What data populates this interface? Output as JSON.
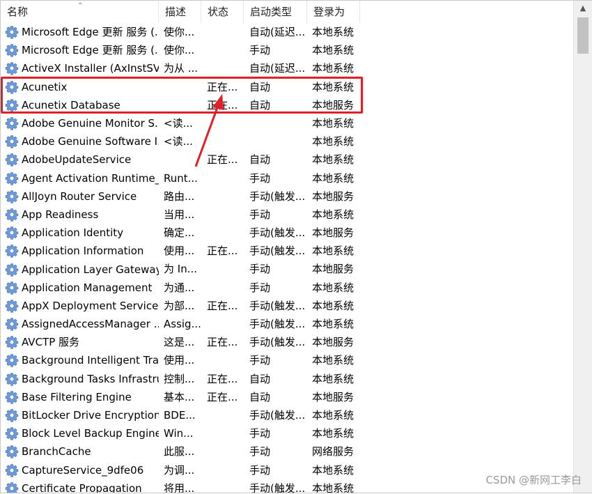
{
  "columns": {
    "name": "名称",
    "description": "描述",
    "status": "状态",
    "startup_type": "启动类型",
    "logon_as": "登录为"
  },
  "services": [
    {
      "name": "Microsoft Edge 更新 服务 (...",
      "description": "使你...",
      "status": "",
      "startup_type": "自动(延迟...",
      "logon_as": "本地系统"
    },
    {
      "name": "Microsoft Edge 更新 服务 (...",
      "description": "使你...",
      "status": "",
      "startup_type": "手动",
      "logon_as": "本地系统"
    },
    {
      "name": "ActiveX Installer (AxInstSV)",
      "description": "为从 ...",
      "status": "",
      "startup_type": "自动(延迟...",
      "logon_as": "本地系统"
    },
    {
      "name": "Acunetix",
      "description": "",
      "status": "正在...",
      "startup_type": "自动",
      "logon_as": "本地系统"
    },
    {
      "name": "Acunetix Database",
      "description": "",
      "status": "正在...",
      "startup_type": "自动",
      "logon_as": "本地服务"
    },
    {
      "name": "Adobe Genuine Monitor S...",
      "description": "<读...",
      "status": "",
      "startup_type": "",
      "logon_as": "本地系统"
    },
    {
      "name": "Adobe Genuine Software I...",
      "description": "<读...",
      "status": "",
      "startup_type": "",
      "logon_as": "本地系统"
    },
    {
      "name": "AdobeUpdateService",
      "description": "",
      "status": "正在...",
      "startup_type": "自动",
      "logon_as": "本地系统"
    },
    {
      "name": "Agent Activation Runtime_...",
      "description": "Runt...",
      "status": "",
      "startup_type": "手动",
      "logon_as": "本地系统"
    },
    {
      "name": "AllJoyn Router Service",
      "description": "路由...",
      "status": "",
      "startup_type": "手动(触发...",
      "logon_as": "本地服务"
    },
    {
      "name": "App Readiness",
      "description": "当用...",
      "status": "",
      "startup_type": "手动",
      "logon_as": "本地系统"
    },
    {
      "name": "Application Identity",
      "description": "确定...",
      "status": "",
      "startup_type": "手动(触发...",
      "logon_as": "本地服务"
    },
    {
      "name": "Application Information",
      "description": "使用...",
      "status": "正在...",
      "startup_type": "手动(触发...",
      "logon_as": "本地系统"
    },
    {
      "name": "Application Layer Gateway ...",
      "description": "为 In...",
      "status": "",
      "startup_type": "手动",
      "logon_as": "本地服务"
    },
    {
      "name": "Application Management",
      "description": "为通...",
      "status": "",
      "startup_type": "手动",
      "logon_as": "本地系统"
    },
    {
      "name": "AppX Deployment Service ...",
      "description": "为部...",
      "status": "正在...",
      "startup_type": "手动(触发...",
      "logon_as": "本地系统"
    },
    {
      "name": "AssignedAccessManager ...",
      "description": "Assig...",
      "status": "",
      "startup_type": "手动(触发...",
      "logon_as": "本地系统"
    },
    {
      "name": "AVCTP 服务",
      "description": "这是...",
      "status": "正在...",
      "startup_type": "手动(触发...",
      "logon_as": "本地服务"
    },
    {
      "name": "Background Intelligent Tra...",
      "description": "使用...",
      "status": "",
      "startup_type": "手动",
      "logon_as": "本地系统"
    },
    {
      "name": "Background Tasks Infrastru...",
      "description": "控制...",
      "status": "正在...",
      "startup_type": "自动",
      "logon_as": "本地系统"
    },
    {
      "name": "Base Filtering Engine",
      "description": "基本...",
      "status": "正在...",
      "startup_type": "自动",
      "logon_as": "本地服务"
    },
    {
      "name": "BitLocker Drive Encryption ...",
      "description": "BDE...",
      "status": "",
      "startup_type": "手动(触发...",
      "logon_as": "本地系统"
    },
    {
      "name": "Block Level Backup Engine ...",
      "description": "Win...",
      "status": "",
      "startup_type": "手动",
      "logon_as": "本地系统"
    },
    {
      "name": "BranchCache",
      "description": "此服...",
      "status": "",
      "startup_type": "手动",
      "logon_as": "网络服务"
    },
    {
      "name": "CaptureService_9dfe06",
      "description": "为调...",
      "status": "",
      "startup_type": "手动",
      "logon_as": "本地系统"
    },
    {
      "name": "Certificate Propagation",
      "description": "将用...",
      "status": "",
      "startup_type": "手动(触发...",
      "logon_as": "本地系统"
    }
  ],
  "watermark": "CSDN @新网工李白",
  "colors": {
    "highlight": "#e11f26",
    "gear_blue": "#5b8fd6",
    "scrollbar_thumb": "#c2c2c2"
  },
  "icons": {
    "service": "gear-icon",
    "sort": "sort-ascending-icon",
    "scroll_up": "scroll-up-arrow-icon"
  }
}
